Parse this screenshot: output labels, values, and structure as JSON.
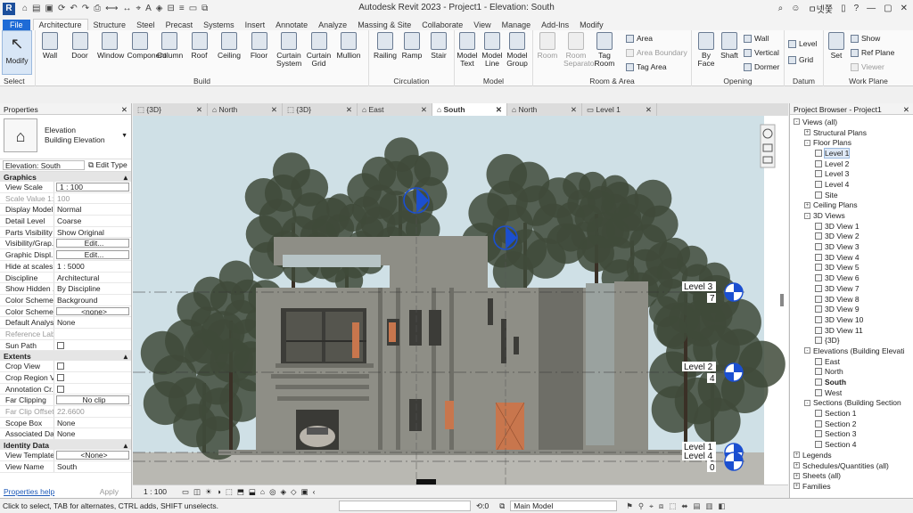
{
  "app": {
    "title": "Autodesk Revit 2023 - Project1 - Elevation: South",
    "logo": "R",
    "username": "ㅁ넷쫓",
    "quick_access_icons": [
      "home-icon",
      "open-icon",
      "save-icon",
      "sync-icon",
      "undo-icon",
      "redo-icon",
      "print-icon",
      "measure-icon",
      "dimension-icon",
      "tag-icon",
      "text-icon",
      "3d-view-icon",
      "section-icon",
      "thin-lines-icon",
      "close-hidden-icon",
      "switch-windows-icon"
    ]
  },
  "ribbon_tabs": [
    "File",
    "Architecture",
    "Structure",
    "Steel",
    "Precast",
    "Systems",
    "Insert",
    "Annotate",
    "Analyze",
    "Massing & Site",
    "Collaborate",
    "View",
    "Manage",
    "Add-Ins",
    "Modify"
  ],
  "active_tab": "Architecture",
  "ribbon": {
    "select": {
      "modify": "Modify",
      "label": "Select"
    },
    "build": {
      "label": "Build",
      "buttons": [
        "Wall",
        "Door",
        "Window",
        "Component",
        "Column",
        "Roof",
        "Ceiling",
        "Floor",
        "Curtain System",
        "Curtain Grid",
        "Mullion"
      ]
    },
    "circulation": {
      "label": "Circulation",
      "buttons": [
        "Railing",
        "Ramp",
        "Stair"
      ]
    },
    "model": {
      "label": "Model",
      "buttons": [
        "Model Text",
        "Model Line",
        "Model Group"
      ]
    },
    "room_area": {
      "label": "Room & Area",
      "buttons": [
        "Room",
        "Room Separator",
        "Tag Room"
      ],
      "small": [
        "Area",
        "Area Boundary",
        "Tag Area"
      ]
    },
    "opening": {
      "label": "Opening",
      "buttons": [
        "By Face",
        "Shaft"
      ],
      "small": [
        "Wall",
        "Vertical",
        "Dormer"
      ]
    },
    "datum": {
      "label": "Datum",
      "small": [
        "Level",
        "Grid"
      ]
    },
    "work_plane": {
      "label": "Work Plane",
      "buttons": [
        "Set"
      ],
      "small": [
        "Show",
        "Ref Plane",
        "Viewer"
      ]
    }
  },
  "properties": {
    "title": "Properties",
    "type_name": "Elevation",
    "type_sub": "Building Elevation",
    "instance": "Elevation: South",
    "edit_type": "Edit Type",
    "groups": [
      {
        "name": "Graphics",
        "rows": [
          {
            "k": "View Scale",
            "v": "1 : 100",
            "style": "boxed"
          },
          {
            "k": "Scale Value   1:",
            "v": "100",
            "dim": true
          },
          {
            "k": "Display Model",
            "v": "Normal"
          },
          {
            "k": "Detail Level",
            "v": "Coarse"
          },
          {
            "k": "Parts Visibility",
            "v": "Show Original"
          },
          {
            "k": "Visibility/Grap...",
            "v": "Edit...",
            "style": "btn"
          },
          {
            "k": "Graphic Displ...",
            "v": "Edit...",
            "style": "btn"
          },
          {
            "k": "Hide at scales ...",
            "v": "1 : 5000"
          },
          {
            "k": "Discipline",
            "v": "Architectural"
          },
          {
            "k": "Show Hidden ...",
            "v": "By Discipline"
          },
          {
            "k": "Color Scheme ...",
            "v": "Background"
          },
          {
            "k": "Color Scheme",
            "v": "<none>",
            "style": "btn"
          },
          {
            "k": "Default Analys...",
            "v": "None"
          },
          {
            "k": "Reference Label",
            "v": "",
            "dim": true
          },
          {
            "k": "Sun Path",
            "v": "",
            "style": "check"
          }
        ]
      },
      {
        "name": "Extents",
        "rows": [
          {
            "k": "Crop View",
            "v": "",
            "style": "check"
          },
          {
            "k": "Crop Region V...",
            "v": "",
            "style": "check"
          },
          {
            "k": "Annotation Cr...",
            "v": "",
            "style": "check"
          },
          {
            "k": "Far Clipping",
            "v": "No clip",
            "style": "btn"
          },
          {
            "k": "Far Clip Offset",
            "v": "22.6600",
            "dim": true
          },
          {
            "k": "Scope Box",
            "v": "None"
          },
          {
            "k": "Associated Da...",
            "v": "None"
          }
        ]
      },
      {
        "name": "Identity Data",
        "rows": [
          {
            "k": "View Template",
            "v": "<None>",
            "style": "btn"
          },
          {
            "k": "View Name",
            "v": "South"
          }
        ]
      }
    ],
    "help": "Properties help",
    "apply": "Apply"
  },
  "view_tabs": [
    {
      "label": "{3D}",
      "active": false
    },
    {
      "label": "North",
      "active": false
    },
    {
      "label": "{3D}",
      "active": false
    },
    {
      "label": "East",
      "active": false
    },
    {
      "label": "South",
      "active": true
    },
    {
      "label": "North",
      "active": false
    },
    {
      "label": "Level 1",
      "active": false
    }
  ],
  "elevation": {
    "levels": [
      {
        "name": "Level 3",
        "value": "7"
      },
      {
        "name": "Level 2",
        "value": "4"
      },
      {
        "name": "Level 1",
        "value": "0"
      },
      {
        "name": "Level 4",
        "value": "0"
      }
    ],
    "colors": {
      "sky": "#cfe0e6",
      "ground": "#b9b8b2",
      "wall": "#8e8e86",
      "wall_dark": "#6e6e67",
      "door": "#c8764d",
      "tree": "#3f4a3a",
      "level_marker": "#1b4fd0"
    }
  },
  "view_bar": {
    "scale": "1 : 100"
  },
  "browser": {
    "title": "Project Browser - Project1",
    "nodes": [
      {
        "t": "Views (all)",
        "d": 0,
        "ex": "-"
      },
      {
        "t": "Structural Plans",
        "d": 1,
        "ex": "+"
      },
      {
        "t": "Floor Plans",
        "d": 1,
        "ex": "-"
      },
      {
        "t": "Level 1",
        "d": 2,
        "hl": true
      },
      {
        "t": "Level 2",
        "d": 2
      },
      {
        "t": "Level 3",
        "d": 2
      },
      {
        "t": "Level 4",
        "d": 2
      },
      {
        "t": "Site",
        "d": 2
      },
      {
        "t": "Ceiling Plans",
        "d": 1,
        "ex": "+"
      },
      {
        "t": "3D Views",
        "d": 1,
        "ex": "-"
      },
      {
        "t": "3D View 1",
        "d": 2
      },
      {
        "t": "3D View 2",
        "d": 2
      },
      {
        "t": "3D View 3",
        "d": 2
      },
      {
        "t": "3D View 4",
        "d": 2
      },
      {
        "t": "3D View 5",
        "d": 2
      },
      {
        "t": "3D View 6",
        "d": 2
      },
      {
        "t": "3D View 7",
        "d": 2
      },
      {
        "t": "3D View 8",
        "d": 2
      },
      {
        "t": "3D View 9",
        "d": 2
      },
      {
        "t": "3D View 10",
        "d": 2
      },
      {
        "t": "3D View 11",
        "d": 2
      },
      {
        "t": "{3D}",
        "d": 2
      },
      {
        "t": "Elevations (Building Elevati",
        "d": 1,
        "ex": "-"
      },
      {
        "t": "East",
        "d": 2
      },
      {
        "t": "North",
        "d": 2
      },
      {
        "t": "South",
        "d": 2,
        "sel": true
      },
      {
        "t": "West",
        "d": 2
      },
      {
        "t": "Sections (Building Section",
        "d": 1,
        "ex": "-"
      },
      {
        "t": "Section 1",
        "d": 2
      },
      {
        "t": "Section 2",
        "d": 2
      },
      {
        "t": "Section 3",
        "d": 2
      },
      {
        "t": "Section 4",
        "d": 2
      },
      {
        "t": "Legends",
        "d": 0,
        "ex": "+"
      },
      {
        "t": "Schedules/Quantities (all)",
        "d": 0,
        "ex": "+"
      },
      {
        "t": "Sheets (all)",
        "d": 0,
        "ex": "+"
      },
      {
        "t": "Families",
        "d": 0,
        "ex": "+"
      }
    ]
  },
  "status": {
    "message": "Click to select, TAB for alternates, CTRL adds, SHIFT unselects.",
    "zero": ":0",
    "model": "Main Model"
  }
}
